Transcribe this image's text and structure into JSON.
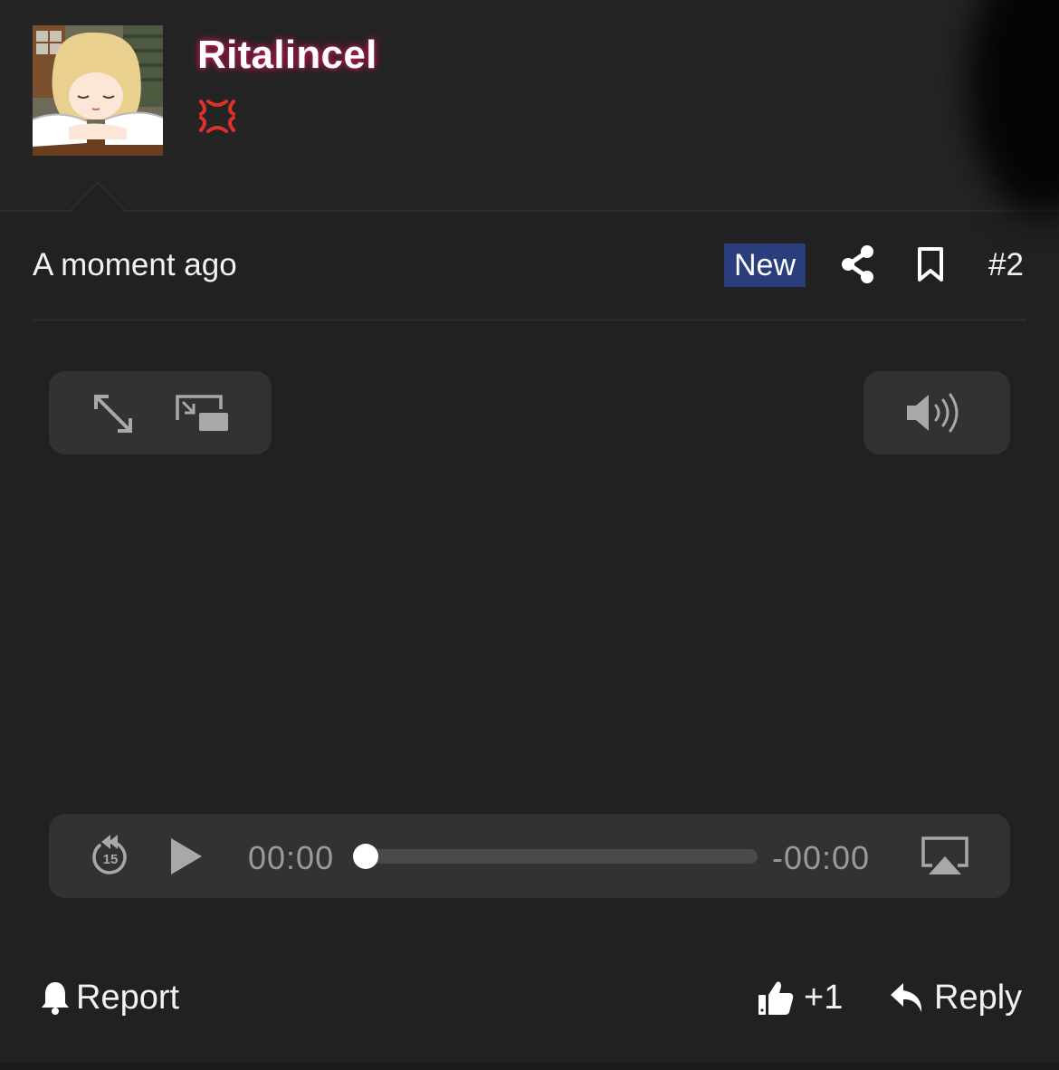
{
  "user": {
    "name": "Ritalincel",
    "avatar_icon": "anime-girl-sleeping-avatar",
    "status_icon": "anger-symbol-icon",
    "name_glow_color": "#c21a5a"
  },
  "post": {
    "timestamp": "A moment ago",
    "badge": "New",
    "badge_color": "#2a3e7e",
    "number": "#2",
    "share_icon": "share-icon",
    "bookmark_icon": "bookmark-icon"
  },
  "player": {
    "expand_icon": "expand-icon",
    "pip_icon": "picture-in-picture-icon",
    "volume_icon": "volume-icon",
    "skip_back_icon": "skip-back-15-icon",
    "skip_back_seconds": "15",
    "play_icon": "play-icon",
    "current_time": "00:00",
    "remaining_time": "-00:00",
    "progress": 0,
    "airplay_icon": "airplay-icon"
  },
  "actions": {
    "report_label": "Report",
    "report_icon": "bell-icon",
    "like_label": "+1",
    "like_icon": "thumbs-up-icon",
    "reply_label": "Reply",
    "reply_icon": "reply-arrow-icon"
  }
}
